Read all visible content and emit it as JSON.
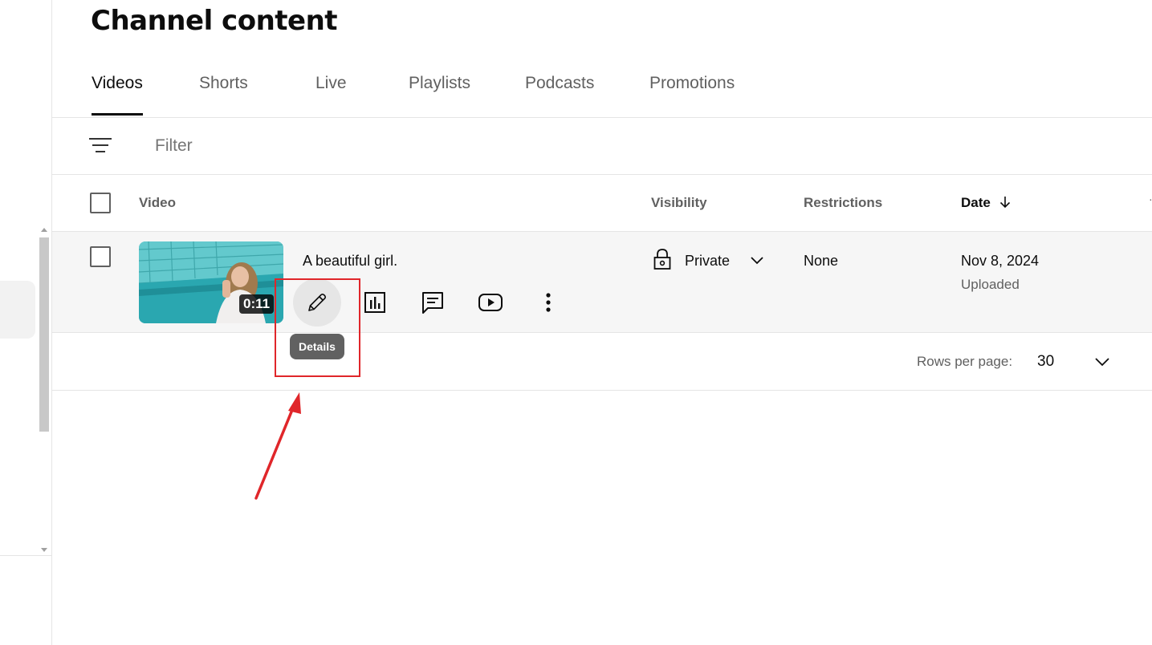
{
  "page": {
    "title": "Channel content"
  },
  "tabs": [
    {
      "label": "Videos",
      "active": true
    },
    {
      "label": "Shorts"
    },
    {
      "label": "Live"
    },
    {
      "label": "Playlists"
    },
    {
      "label": "Podcasts"
    },
    {
      "label": "Promotions"
    }
  ],
  "filter": {
    "placeholder": "Filter",
    "icon": "filter-icon"
  },
  "table": {
    "headers": {
      "video": "Video",
      "visibility": "Visibility",
      "restrictions": "Restrictions",
      "date": "Date"
    },
    "sort_icon": "arrow-down-icon",
    "rows": [
      {
        "duration": "0:11",
        "title": "A beautiful girl.",
        "visibility": "Private",
        "restrictions": "None",
        "date": "Nov 8, 2024",
        "date_status": "Uploaded",
        "actions": [
          "pencil-icon",
          "analytics-icon",
          "comments-icon",
          "youtube-icon",
          "more-vert-icon"
        ]
      }
    ]
  },
  "tooltip": {
    "text": "Details"
  },
  "pagination": {
    "rows_label": "Rows per page:",
    "rows_value": "30"
  },
  "colors": {
    "annotation": "#e0262a",
    "tooltip_bg": "#616161",
    "row_bg": "#f6f6f6"
  }
}
